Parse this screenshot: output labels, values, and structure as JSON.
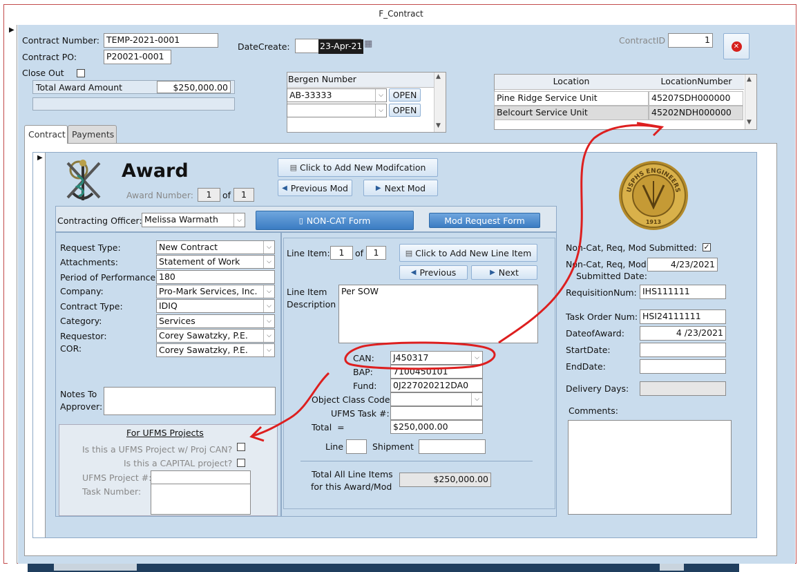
{
  "window": {
    "title": "F_Contract"
  },
  "header": {
    "contract_number_label": "Contract Number:",
    "contract_number": "TEMP-2021-0001",
    "contract_po_label": "Contract PO:",
    "contract_po": "P20021-0001",
    "close_out_label": "Close Out",
    "total_award_label": "Total Award Amount",
    "total_award": "$250,000.00",
    "date_create_label": "DateCreate:",
    "date_create": "23-Apr-21",
    "contract_id_label": "ContractID",
    "contract_id": "1"
  },
  "bergen": {
    "header": "Bergen Number",
    "rows": [
      {
        "value": "AB-33333",
        "button": "OPEN"
      },
      {
        "value": "",
        "button": "OPEN"
      }
    ]
  },
  "location_table": {
    "headers": [
      "Location",
      "LocationNumber"
    ],
    "rows": [
      {
        "location": "Pine Ridge Service Unit",
        "number": "45207SDH000000"
      },
      {
        "location": "Belcourt Service Unit",
        "number": "45202NDH000000"
      }
    ]
  },
  "tabs": [
    {
      "label": "Contract"
    },
    {
      "label": "Payments"
    }
  ],
  "award": {
    "title": "Award",
    "award_number_label": "Award Number:",
    "award_number": "1",
    "of_label": "of",
    "award_total": "1",
    "add_mod_button": "Click to Add New Modifcation",
    "prev_mod_button": "Previous Mod",
    "next_mod_button": "Next Mod",
    "seal_top_text": "USPHS ENGINEERS",
    "seal_year": "1913"
  },
  "officer": {
    "label": "Contracting Officer:",
    "value": "Melissa Warmath",
    "noncat_button": "NON-CAT Form",
    "modreq_button": "Mod Request Form"
  },
  "left_form": {
    "request_type_label": "Request Type:",
    "request_type": "New Contract",
    "attachments_label": "Attachments:",
    "attachments": "Statement of Work",
    "period_label": "Period of Performance",
    "period": "180",
    "company_label": "Company:",
    "company": "Pro-Mark Services, Inc.",
    "contract_type_label": "Contract Type:",
    "contract_type": "IDIQ",
    "category_label": "Category:",
    "category": "Services",
    "requestor_label": "Requestor:",
    "requestor": "Corey Sawatzky, P.E.",
    "cor_label": "COR:",
    "cor": "Corey Sawatzky, P.E.",
    "notes_label_1": "Notes To",
    "notes_label_2": "Approver:",
    "notes": ""
  },
  "ufms": {
    "title": "For UFMS Projects",
    "q1": "Is this a UFMS Project w/ Proj CAN?",
    "q2": "Is this a CAPITAL project?",
    "project_label": "UFMS Project #:",
    "task_label": "Task Number:"
  },
  "line_item": {
    "label": "Line Item:",
    "index": "1",
    "of_label": "of",
    "total_count": "1",
    "add_button": "Click to Add New Line Item",
    "prev_button": "Previous",
    "next_button": "Next",
    "desc_label_1": "Line Item",
    "desc_label_2": "Description",
    "description": "Per SOW",
    "can_label": "CAN:",
    "can": "J450317",
    "bap_label": "BAP:",
    "bap": "7100450101",
    "fund_label": "Fund:",
    "fund": "0J227020212DA0",
    "occ_label": "Object Class Code",
    "occ": "",
    "ufms_task_label": "UFMS Task #:",
    "ufms_task": "",
    "total_label": "Total  =",
    "total": "$250,000.00",
    "line_label": "Line",
    "shipment_label": "Shipment",
    "total_all_label_1": "Total All Line Items",
    "total_all_label_2": "for this Award/Mod",
    "total_all": "$250,000.00"
  },
  "right_form": {
    "submitted_label": "Non-Cat, Req, Mod Submitted:",
    "submitted_date_label_1": "Non-Cat, Req, Mod",
    "submitted_date_label_2": "Submitted Date:",
    "submitted_date": "4/23/2021",
    "requisition_label": "RequisitionNum:",
    "requisition": "IHS111111",
    "task_order_label": "Task Order Num:",
    "task_order": "HSI24111111",
    "date_award_label": "DateofAward:",
    "date_award": "4 /23/2021",
    "start_label": "StartDate:",
    "end_label": "EndDate:",
    "delivery_label": "Delivery Days:",
    "comments_label": "Comments:"
  },
  "colors": {
    "form_bg": "#c9dced",
    "annotation": "#dd1f1f",
    "accent_button": "#3b7cc2"
  }
}
